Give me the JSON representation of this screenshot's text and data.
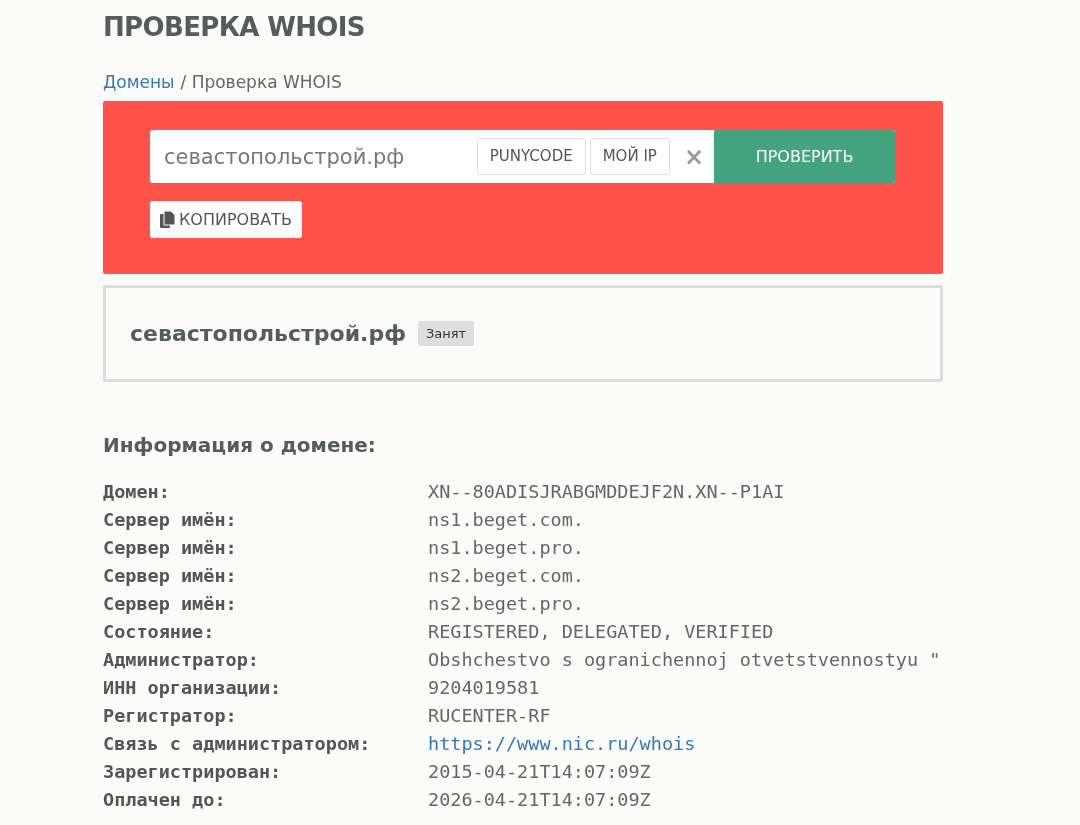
{
  "title": "ПРОВЕРКА WHOIS",
  "breadcrumb": [
    {
      "label": "Домены",
      "kind": "link"
    },
    {
      "label": "/ Проверка WHOIS",
      "kind": "text"
    }
  ],
  "search": {
    "value": "севастопольстрой.рф",
    "buttons": [
      "PUNYCODE",
      "МОЙ IP"
    ],
    "clear": "×",
    "submit": "ПРОВЕРИТЬ",
    "copy": "КОПИРОВАТЬ"
  },
  "result": {
    "domain": "севастопольстрой.рф",
    "status": "Занят"
  },
  "info": {
    "heading": "Информация о домене:",
    "rows": [
      {
        "label": "Домен:",
        "value": "XN--80ADISJRABGMDDEJF2N.XN--P1AI",
        "kind": "text"
      },
      {
        "label": "Сервер имён:",
        "value": "ns1.beget.com.",
        "kind": "text"
      },
      {
        "label": "Сервер имён:",
        "value": "ns1.beget.pro.",
        "kind": "text"
      },
      {
        "label": "Сервер имён:",
        "value": "ns2.beget.com.",
        "kind": "text"
      },
      {
        "label": "Сервер имён:",
        "value": "ns2.beget.pro.",
        "kind": "text"
      },
      {
        "label": "Состояние:",
        "value": "REGISTERED, DELEGATED, VERIFIED",
        "kind": "text"
      },
      {
        "label": "Администратор:",
        "value": "Obshchestvo s ogranichennoj otvetstvennostyu \"",
        "kind": "text"
      },
      {
        "label": "ИНН организации:",
        "value": "9204019581",
        "kind": "text"
      },
      {
        "label": "Регистратор:",
        "value": "RUCENTER-RF",
        "kind": "text"
      },
      {
        "label": "Связь с администратором:",
        "value": "https://www.nic.ru/whois",
        "kind": "link"
      },
      {
        "label": "Зарегистрирован:",
        "value": "2015-04-21T14:07:09Z",
        "kind": "text"
      },
      {
        "label": "Оплачен до:",
        "value": "2026-04-21T14:07:09Z",
        "kind": "text"
      }
    ]
  }
}
